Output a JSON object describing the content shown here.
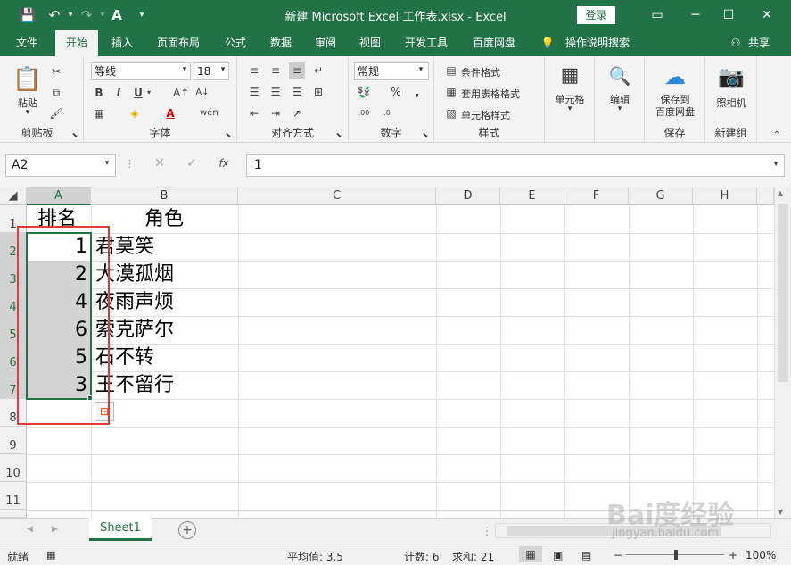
{
  "window": {
    "title": "新建 Microsoft Excel 工作表.xlsx  -  Excel",
    "login_label": "登录"
  },
  "tabs": [
    "文件",
    "开始",
    "插入",
    "页面布局",
    "公式",
    "数据",
    "审阅",
    "视图",
    "开发工具",
    "百度网盘"
  ],
  "active_tab": "开始",
  "tell_me": "操作说明搜索",
  "share_label": "共享",
  "ribbon": {
    "clipboard": {
      "paste_label": "粘贴",
      "group_label": "剪贴板"
    },
    "font": {
      "font_name": "等线",
      "font_size": "18",
      "group_label": "字体"
    },
    "alignment": {
      "group_label": "对齐方式"
    },
    "number": {
      "format": "常规",
      "group_label": "数字"
    },
    "styles": {
      "conditional": "条件格式",
      "table": "套用表格格式",
      "cell_styles": "单元格样式",
      "group_label": "样式"
    },
    "cells": {
      "label": "单元格"
    },
    "editing": {
      "label": "编辑"
    },
    "save": {
      "label_line1": "保存到",
      "label_line2": "百度网盘",
      "group_label": "保存"
    },
    "camera": {
      "label": "照相机",
      "group_label": "新建组"
    }
  },
  "formula_bar": {
    "name_box": "A2",
    "formula": "1",
    "fx_label": "fx"
  },
  "columns": [
    "A",
    "B",
    "C",
    "D",
    "E",
    "F",
    "G",
    "H"
  ],
  "rows": [
    "1",
    "2",
    "3",
    "4",
    "5",
    "6",
    "7",
    "8",
    "9",
    "10",
    "11"
  ],
  "cells": {
    "A1": "排名",
    "B1": "角色",
    "A2": "1",
    "B2": "君莫笑",
    "A3": "2",
    "B3": "大漠孤烟",
    "A4": "4",
    "B4": "夜雨声烦",
    "A5": "6",
    "B5": "索克萨尔",
    "A6": "5",
    "B6": "石不转",
    "A7": "3",
    "B7": "王不留行"
  },
  "sheet_tab": "Sheet1",
  "status": {
    "ready": "就绪",
    "average": "平均值: 3.5",
    "count": "计数: 6",
    "sum": "求和: 21",
    "zoom": "100%"
  },
  "watermark": {
    "line1": "Bai度经验",
    "line2": "jingyan.baidu.com"
  },
  "colors": {
    "excel_green": "#217346",
    "highlight_red": "#e53935",
    "selection_fill": "#d3d3d3"
  }
}
